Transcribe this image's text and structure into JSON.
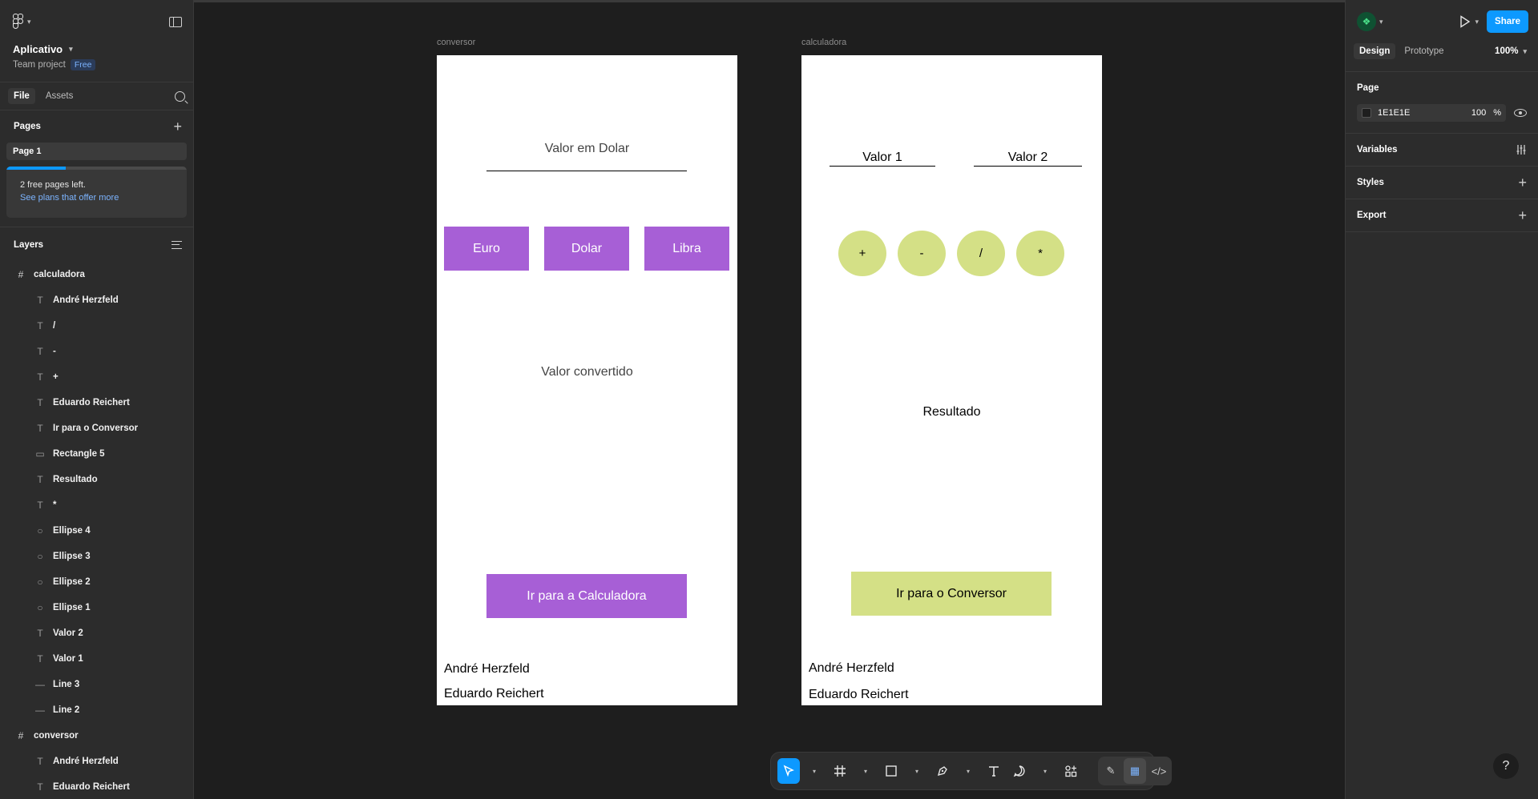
{
  "left": {
    "project_name": "Aplicativo",
    "project_team": "Team project",
    "plan_badge": "Free",
    "tabs": [
      {
        "label": "File"
      },
      {
        "label": "Assets"
      }
    ],
    "pages_heading": "Pages",
    "page_item": "Page 1",
    "pages_notice": "2 free pages left.",
    "pages_link": "See plans that offer more",
    "pages_used_fraction": 0.33,
    "layers_heading": "Layers",
    "layers": [
      {
        "label": "calculadora",
        "icon": "#",
        "type": "frame"
      },
      {
        "label": "André Herzfeld",
        "icon": "T",
        "type": "child"
      },
      {
        "label": "/",
        "icon": "T",
        "type": "child"
      },
      {
        "label": "-",
        "icon": "T",
        "type": "child"
      },
      {
        "label": "+",
        "icon": "T",
        "type": "child"
      },
      {
        "label": "Eduardo Reichert",
        "icon": "T",
        "type": "child"
      },
      {
        "label": "Ir para o Conversor",
        "icon": "T",
        "type": "child"
      },
      {
        "label": "Rectangle 5",
        "icon": "▭",
        "type": "child"
      },
      {
        "label": "Resultado",
        "icon": "T",
        "type": "child"
      },
      {
        "label": "*",
        "icon": "T",
        "type": "child"
      },
      {
        "label": "Ellipse 4",
        "icon": "○",
        "type": "child"
      },
      {
        "label": "Ellipse 3",
        "icon": "○",
        "type": "child"
      },
      {
        "label": "Ellipse 2",
        "icon": "○",
        "type": "child"
      },
      {
        "label": "Ellipse 1",
        "icon": "○",
        "type": "child"
      },
      {
        "label": "Valor 2",
        "icon": "T",
        "type": "child"
      },
      {
        "label": "Valor 1",
        "icon": "T",
        "type": "child"
      },
      {
        "label": "Line 3",
        "icon": "—",
        "type": "child"
      },
      {
        "label": "Line 2",
        "icon": "—",
        "type": "child"
      },
      {
        "label": "conversor",
        "icon": "#",
        "type": "frame"
      },
      {
        "label": "André Herzfeld",
        "icon": "T",
        "type": "child"
      },
      {
        "label": "Eduardo Reichert",
        "icon": "T",
        "type": "child"
      }
    ]
  },
  "canvas": {
    "conversor": {
      "label": "conversor",
      "input_label": "Valor em Dolar",
      "currency_buttons": [
        "Euro",
        "Dolar",
        "Libra"
      ],
      "result_label": "Valor convertido",
      "nav_button": "Ir para a Calculadora",
      "author1": "André Herzfeld",
      "author2": "Eduardo Reichert"
    },
    "calculadora": {
      "label": "calculadora",
      "value1": "Valor 1",
      "value2": "Valor 2",
      "operators": [
        "+",
        "-",
        "/",
        "*"
      ],
      "result_label": "Resultado",
      "nav_button": "Ir para o Conversor",
      "author1": "André Herzfeld",
      "author2": "Eduardo Reichert"
    },
    "colors": {
      "purple": "#a75fd6",
      "green": "#d4e086",
      "canvas_bg": "#1e1e1e"
    }
  },
  "toolbar": {
    "tools": [
      "move-icon",
      "frame-icon",
      "rectangle-icon",
      "pen-icon",
      "text-icon",
      "comment-icon",
      "actions-icon"
    ],
    "modes": [
      "draw-mode-icon",
      "design-mode-icon",
      "dev-mode-icon"
    ]
  },
  "right": {
    "tabs": [
      {
        "label": "Design"
      },
      {
        "label": "Prototype"
      }
    ],
    "zoom": "100%",
    "share": "Share",
    "page_heading": "Page",
    "page_color": "1E1E1E",
    "page_opacity": "100",
    "percent": "%",
    "variables": "Variables",
    "styles": "Styles",
    "export": "Export",
    "help": "?"
  }
}
